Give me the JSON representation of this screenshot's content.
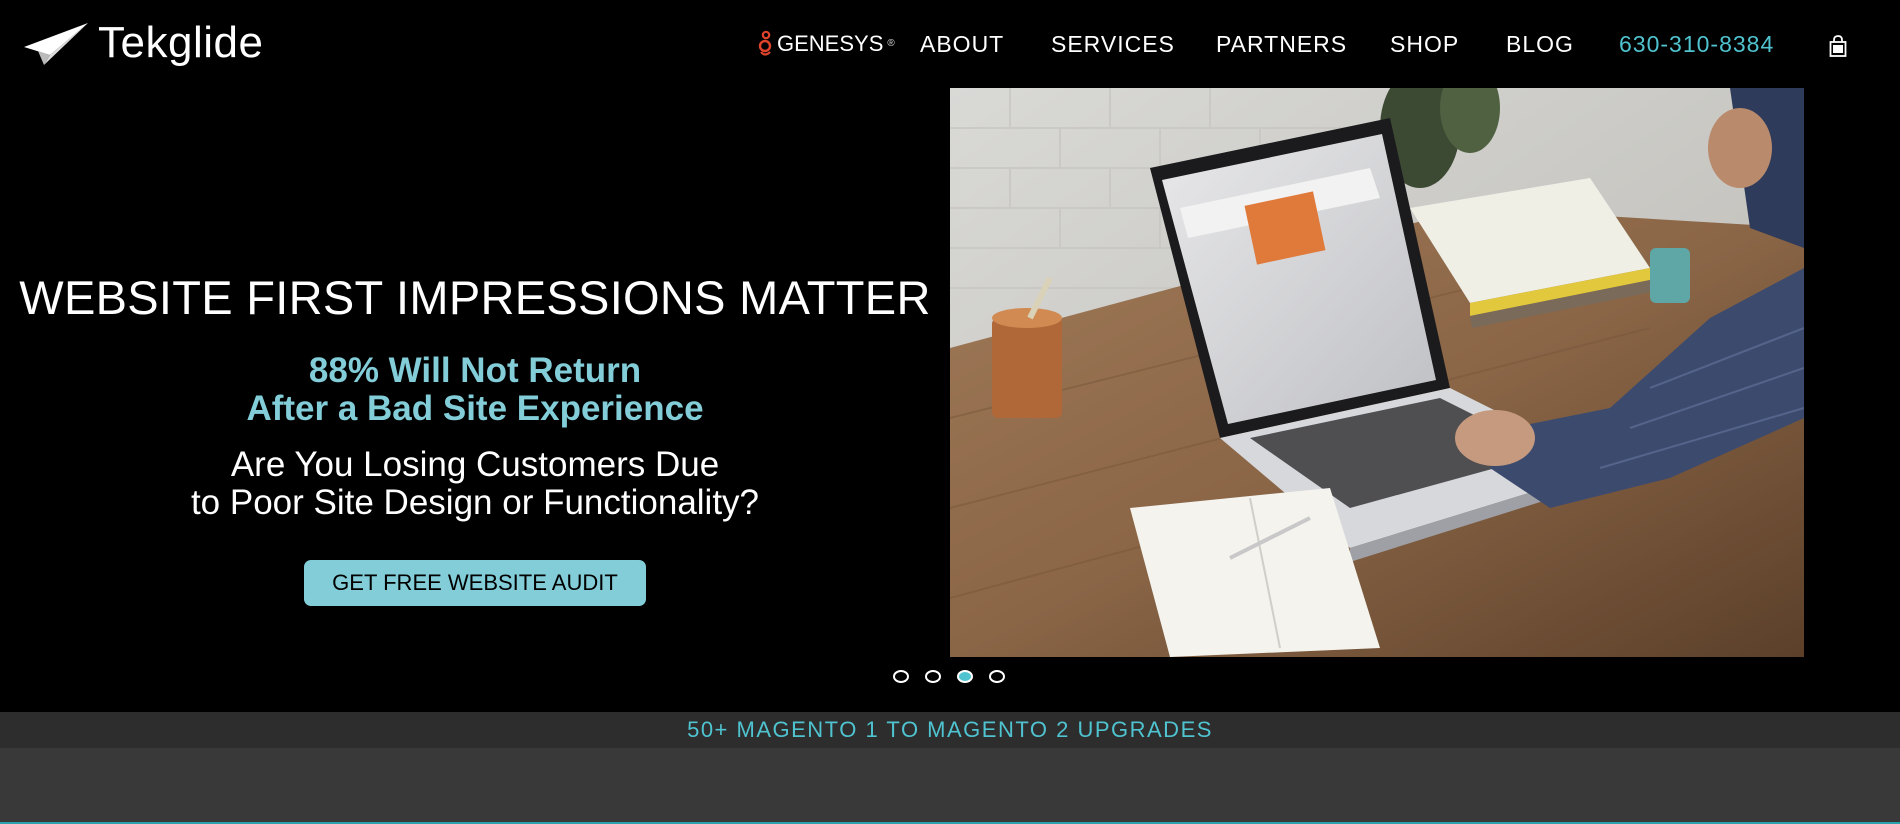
{
  "brand": {
    "name": "Tekglide",
    "logo_icon": "paper-plane-icon"
  },
  "nav": {
    "genesys_label": "GENESYS",
    "genesys_reg": "®",
    "items": [
      {
        "label": "ABOUT"
      },
      {
        "label": "SERVICES"
      },
      {
        "label": "PARTNERS"
      },
      {
        "label": "SHOP"
      },
      {
        "label": "BLOG"
      }
    ],
    "phone": "630-310-8384",
    "cart_icon": "shopping-bag-icon"
  },
  "hero": {
    "title": "WEBSITE FIRST IMPRESSIONS MATTER",
    "sub_line1": "88% Will Not Return",
    "sub_line2": "After a Bad Site Experience",
    "question_line1": "Are You Losing Customers Due",
    "question_line2": "to Poor Site Design or Functionality?",
    "cta_label": "GET FREE WEBSITE AUDIT"
  },
  "slider": {
    "total": 4,
    "active_index": 3
  },
  "ribbon": {
    "text": "50+ MAGENTO 1 TO MAGENTO 2 UPGRADES"
  },
  "colors": {
    "accent": "#4fc3cf",
    "accent_soft": "#82cdd8",
    "background": "#000000",
    "ribbon_bg": "#2d2d2d",
    "genesys_red": "#e0432b"
  }
}
